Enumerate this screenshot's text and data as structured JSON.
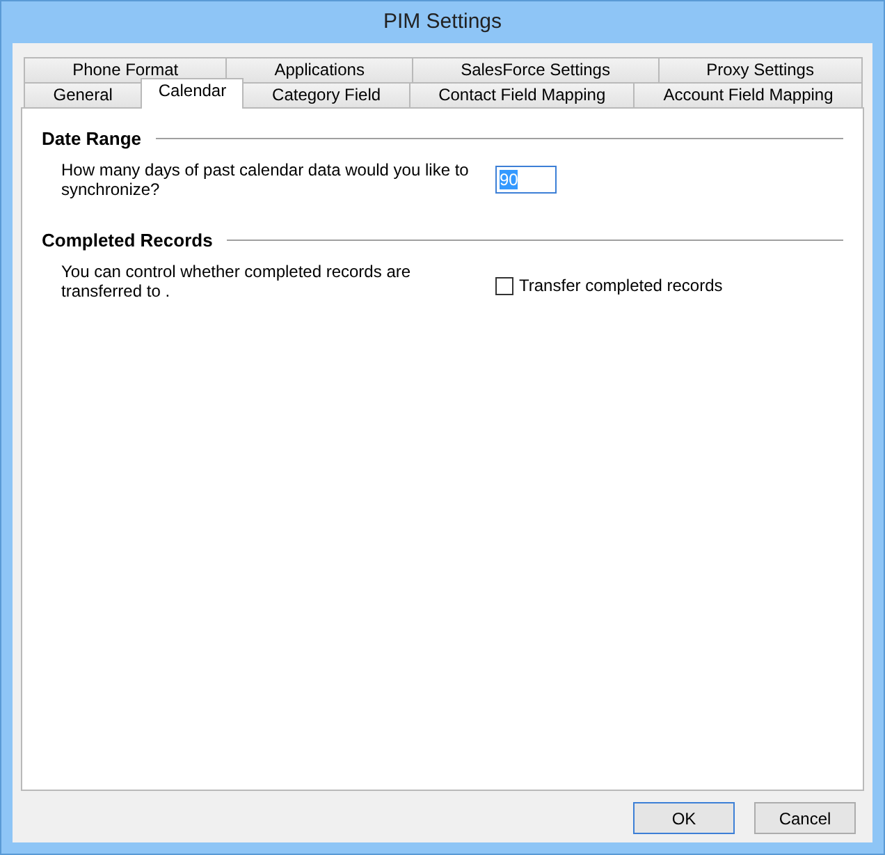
{
  "window": {
    "title": "PIM Settings"
  },
  "tab_rows": [
    [
      {
        "label": "Phone Format",
        "selected": false
      },
      {
        "label": "Applications",
        "selected": false
      },
      {
        "label": "SalesForce Settings",
        "selected": false
      },
      {
        "label": "Proxy Settings",
        "selected": false
      }
    ],
    [
      {
        "label": "General",
        "selected": false
      },
      {
        "label": "Calendar",
        "selected": true
      },
      {
        "label": "Category Field",
        "selected": false
      },
      {
        "label": "Contact Field Mapping",
        "selected": false
      },
      {
        "label": "Account Field Mapping",
        "selected": false
      }
    ]
  ],
  "sections": [
    {
      "heading": "Date Range",
      "description": "How many days of past calendar data would you like to synchronize?",
      "kind": "number",
      "value": "90"
    },
    {
      "heading": "Completed Records",
      "description": "You can control whether completed records are transferred to .",
      "kind": "checkbox",
      "label": "Transfer completed records",
      "checked": false
    }
  ],
  "buttons": [
    {
      "label": "OK",
      "default": true
    },
    {
      "label": "Cancel",
      "default": false
    }
  ]
}
